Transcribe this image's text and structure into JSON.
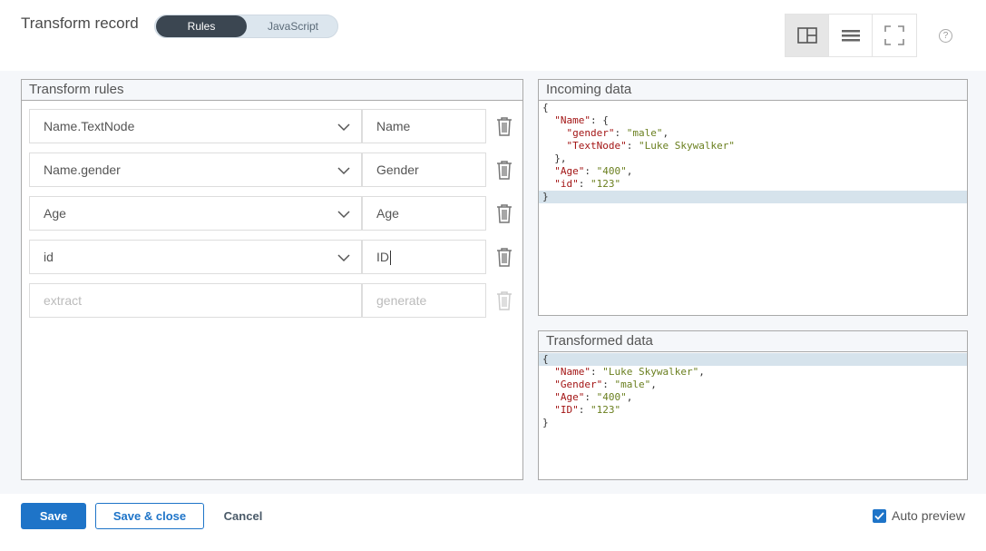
{
  "header": {
    "title": "Transform record",
    "mode_toggle": {
      "active": "Rules",
      "inactive": "JavaScript"
    }
  },
  "view_buttons": [
    "split-view-icon",
    "list-view-icon",
    "fullscreen-icon"
  ],
  "help_label": "?",
  "rules_panel": {
    "title": "Transform rules",
    "rules": [
      {
        "extract": "Name.TextNode",
        "generate": "Name"
      },
      {
        "extract": "Name.gender",
        "generate": "Gender"
      },
      {
        "extract": "Age",
        "generate": "Age"
      },
      {
        "extract": "id",
        "generate": "ID"
      }
    ],
    "new_rule": {
      "extract_placeholder": "extract",
      "generate_placeholder": "generate"
    }
  },
  "incoming_panel": {
    "title": "Incoming data",
    "lines": [
      "{",
      "  \"Name\": {",
      "    \"gender\": \"male\",",
      "    \"TextNode\": \"Luke Skywalker\"",
      "  },",
      "  \"Age\": \"400\",",
      "  \"id\": \"123\"",
      "}"
    ]
  },
  "transformed_panel": {
    "title": "Transformed data",
    "lines": [
      "{",
      "  \"Name\": \"Luke Skywalker\",",
      "  \"Gender\": \"male\",",
      "  \"Age\": \"400\",",
      "  \"ID\": \"123\"",
      "}"
    ]
  },
  "footer": {
    "save": "Save",
    "save_close": "Save & close",
    "cancel": "Cancel",
    "auto_preview": "Auto preview",
    "auto_preview_checked": true
  },
  "colors": {
    "accent": "#1e74c8",
    "toggle_active": "#3b4651",
    "highlight_line": "#d6e3ec"
  }
}
